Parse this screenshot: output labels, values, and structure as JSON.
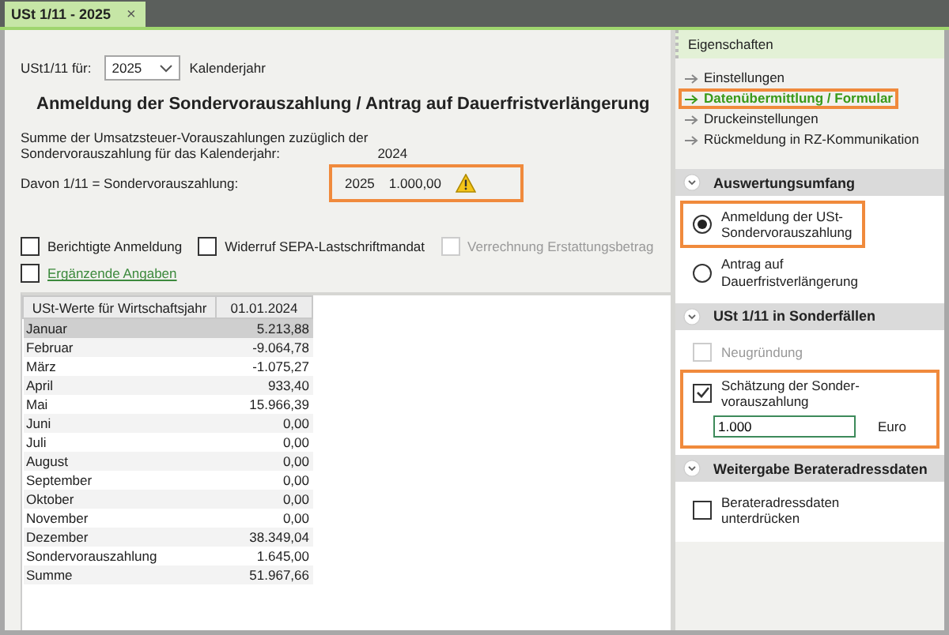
{
  "tab": {
    "label": "USt 1/11 - 2025",
    "close": "×"
  },
  "form": {
    "year_label": "USt1/11 für:",
    "year": "2025",
    "year_unit": "Kalenderjahr",
    "heading": "Anmeldung der Sondervorauszahlung / Antrag auf Dauerfristverlängerung",
    "sum_label": "Summe der Umsatzsteuer-Vorauszahlungen zuzüglich der\nSondervorauszahlung für das Kalenderjahr:",
    "sum_year": "2024",
    "share_label": "Davon 1/11 = Sondervorauszahlung:",
    "share_year": "2025",
    "share_amount": "1.000,00",
    "share_warning": true,
    "share_highlighted": true,
    "checkboxes": [
      {
        "label": "Berichtigte Anmeldung",
        "checked": false,
        "disabled": false
      },
      {
        "label": "Widerruf SEPA-Lastschriftmandat",
        "checked": false,
        "disabled": false
      },
      {
        "label": "Verrechnung Erstattungsbetrag",
        "checked": false,
        "disabled": true
      }
    ],
    "extra": {
      "label": "Ergänzende Angaben",
      "checked": false
    }
  },
  "table": {
    "columns": [
      "USt-Werte für Wirtschaftsjahr",
      "01.01.2024"
    ],
    "rows": [
      {
        "month": "Januar",
        "value": "5.213,88",
        "selected": true
      },
      {
        "month": "Februar",
        "value": "-9.064,78",
        "selected": false
      },
      {
        "month": "März",
        "value": "-1.075,27",
        "selected": false
      },
      {
        "month": "April",
        "value": "933,40",
        "selected": false
      },
      {
        "month": "Mai",
        "value": "15.966,39",
        "selected": false
      },
      {
        "month": "Juni",
        "value": "0,00",
        "selected": false
      },
      {
        "month": "Juli",
        "value": "0,00",
        "selected": false
      },
      {
        "month": "August",
        "value": "0,00",
        "selected": false
      },
      {
        "month": "September",
        "value": "0,00",
        "selected": false
      },
      {
        "month": "Oktober",
        "value": "0,00",
        "selected": false
      },
      {
        "month": "November",
        "value": "0,00",
        "selected": false
      },
      {
        "month": "Dezember",
        "value": "38.349,04",
        "selected": false
      },
      {
        "month": "Sondervorauszahlung",
        "value": "1.645,00",
        "selected": false
      },
      {
        "month": "Summe",
        "value": "51.967,66",
        "selected": false
      }
    ]
  },
  "properties": {
    "title": "Eigenschaften",
    "links": [
      {
        "label": "Einstellungen",
        "active": false,
        "highlighted": false
      },
      {
        "label": "Datenübermittlung / Formular",
        "active": true,
        "highlighted": true
      },
      {
        "label": "Druckeinstellungen",
        "active": false,
        "highlighted": false
      },
      {
        "label": "Rückmeldung in RZ-Kommunikation",
        "active": false,
        "highlighted": false
      }
    ],
    "sections": [
      {
        "title": "Auswertungsumfang",
        "items": [
          {
            "kind": "radio",
            "label": "Anmeldung der USt-\nSondervorauszahlung",
            "selected": true,
            "highlighted": true
          },
          {
            "kind": "radio",
            "label": "Antrag auf\nDauerfristverlängerung",
            "selected": false,
            "highlighted": false
          }
        ]
      },
      {
        "title": "USt 1/11 in Sonderfällen",
        "items": [
          {
            "kind": "checkbox",
            "label": "Neugründung",
            "checked": false,
            "disabled": true,
            "highlighted": false
          },
          {
            "kind": "checkbox",
            "label": "Schätzung der Sonder-\nvorauszahlung",
            "checked": true,
            "disabled": false,
            "highlighted": true,
            "amount": {
              "value": "1.000",
              "unit": "Euro"
            }
          }
        ]
      },
      {
        "title": "Weitergabe Berateradressdaten",
        "items": [
          {
            "kind": "checkbox",
            "label": "Berateradressdaten\nunterdrücken",
            "checked": false,
            "disabled": false,
            "highlighted": false
          }
        ]
      }
    ]
  }
}
